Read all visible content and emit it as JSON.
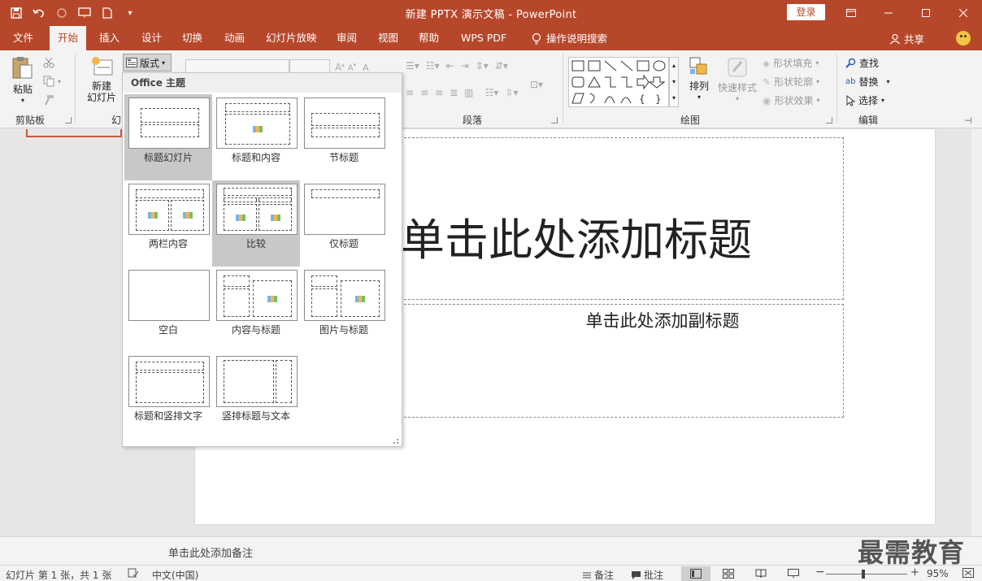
{
  "window": {
    "title": "新建 PPTX 演示文稿 - PowerPoint",
    "login_label": "登录"
  },
  "tabs": [
    {
      "label": "文件"
    },
    {
      "label": "开始"
    },
    {
      "label": "插入"
    },
    {
      "label": "设计"
    },
    {
      "label": "切换"
    },
    {
      "label": "动画"
    },
    {
      "label": "幻灯片放映"
    },
    {
      "label": "审阅"
    },
    {
      "label": "视图"
    },
    {
      "label": "帮助"
    },
    {
      "label": "WPS PDF"
    },
    {
      "label": "操作说明搜索"
    }
  ],
  "share_label": "共享",
  "ribbon": {
    "clipboard": {
      "paste_label": "粘贴",
      "group_label": "剪贴板"
    },
    "slides": {
      "new_slide_label": "新建",
      "new_slide_label2": "幻灯片",
      "layout_label": "版式",
      "group_label_partial": "幻"
    },
    "paragraph": {
      "group_label": "段落"
    },
    "drawing": {
      "group_label": "绘图",
      "arrange_label": "排列",
      "quick_styles_label": "快速样式",
      "shape_fill": "形状填充",
      "shape_outline": "形状轮廓",
      "shape_effects": "形状效果"
    },
    "editing": {
      "group_label": "编辑",
      "find": "查找",
      "replace": "替换",
      "select": "选择"
    }
  },
  "layout_dropdown": {
    "header": "Office 主题",
    "items": [
      {
        "label": "标题幻灯片"
      },
      {
        "label": "标题和内容"
      },
      {
        "label": "节标题"
      },
      {
        "label": "两栏内容"
      },
      {
        "label": "比较"
      },
      {
        "label": "仅标题"
      },
      {
        "label": "空白"
      },
      {
        "label": "内容与标题"
      },
      {
        "label": "图片与标题"
      },
      {
        "label": "标题和竖排文字"
      },
      {
        "label": "竖排标题与文本"
      }
    ]
  },
  "slide": {
    "title_placeholder": "单击此处添加标题",
    "subtitle_placeholder": "单击此处添加副标题"
  },
  "notes_placeholder": "单击此处添加备注",
  "status": {
    "slide_info": "幻灯片 第 1 张，共 1 张",
    "language": "中文(中国)",
    "notes_label": "备注",
    "comments_label": "批注",
    "zoom_level": "95%"
  },
  "colors": {
    "accent": "#b7472a"
  }
}
